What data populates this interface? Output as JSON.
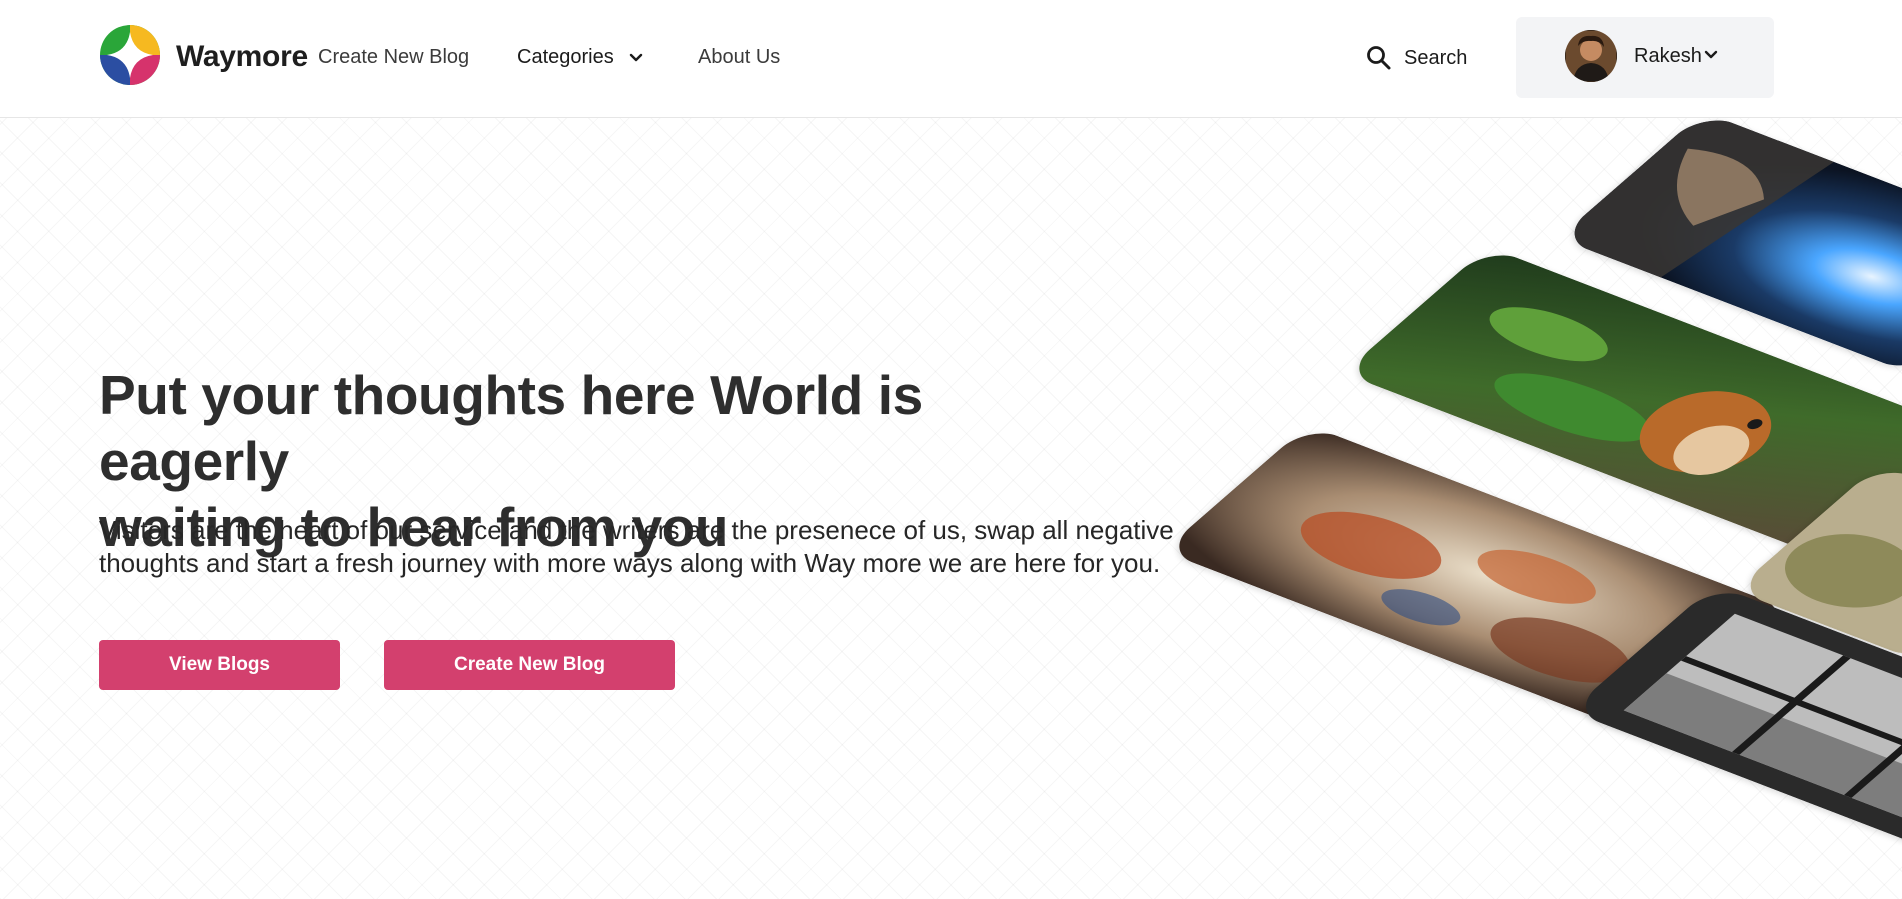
{
  "header": {
    "brand": "Waymore",
    "nav": {
      "create_blog": "Create New Blog",
      "categories": "Categories",
      "about": "About Us"
    },
    "search_label": "Search",
    "user": {
      "name": "Rakesh"
    }
  },
  "hero": {
    "title_line1": "Put your thoughts here World is eagerly",
    "title_line2": "waiting to hear from you",
    "subtitle": "Visitors are the heart of our service and the writers are the presenece of us, swap all negative thoughts and start a fresh journey with more ways along with Way more we are here for you.",
    "buttons": {
      "view": "View Blogs",
      "create": "Create New Blog"
    }
  },
  "colors": {
    "accent": "#d3406e",
    "user_box_bg": "#f3f4f6",
    "logo_green": "#2aa639",
    "logo_yellow": "#f6b920",
    "logo_pink": "#d6336c",
    "logo_blue": "#2b4ea2"
  },
  "icons": {
    "logo": "four-petal-logo-icon",
    "search": "search-icon",
    "chevron": "chevron-down-icon"
  }
}
